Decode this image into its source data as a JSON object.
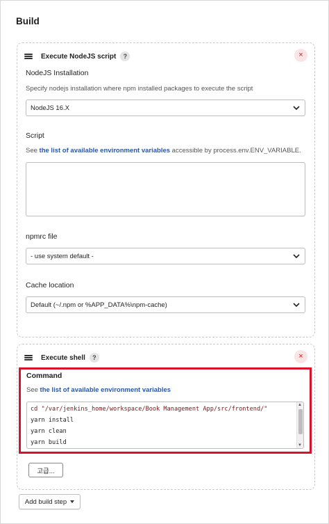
{
  "section": {
    "title": "Build"
  },
  "node_step": {
    "title": "Execute NodeJS script",
    "help": "?",
    "close": "×",
    "installation": {
      "label": "NodeJS Installation",
      "description": "Specify nodejs installation where npm installed packages to execute the script",
      "selected": "NodeJS 16.X"
    },
    "script": {
      "label": "Script",
      "desc_prefix": "See ",
      "desc_link": "the list of available environment variables",
      "desc_suffix": " accessible by process.env.ENV_VARIABLE.",
      "value": ""
    },
    "npmrc": {
      "label": "npmrc file",
      "selected": "- use system default -"
    },
    "cache": {
      "label": "Cache location",
      "selected": "Default (~/.npm or %APP_DATA%\\npm-cache)"
    }
  },
  "shell_step": {
    "title": "Execute shell",
    "help": "?",
    "close": "×",
    "command": {
      "label": "Command",
      "desc_prefix": "See ",
      "desc_link": "the list of available environment variables",
      "lines": [
        "cd \"/var/jenkins_home/workspace/Book Management App/src/frontend/\"",
        "yarn install",
        "yarn clean",
        "yarn build"
      ]
    },
    "advanced_label": "고급..."
  },
  "add_build_step_label": "Add build step",
  "colors": {
    "link": "#2b56a6",
    "highlight": "#d9112b",
    "close": "#d11b1b"
  },
  "icons": [
    "drag-handle-icon",
    "help-icon",
    "close-icon",
    "chevron-down-icon",
    "resize-handle-icon",
    "caret-down-icon"
  ]
}
